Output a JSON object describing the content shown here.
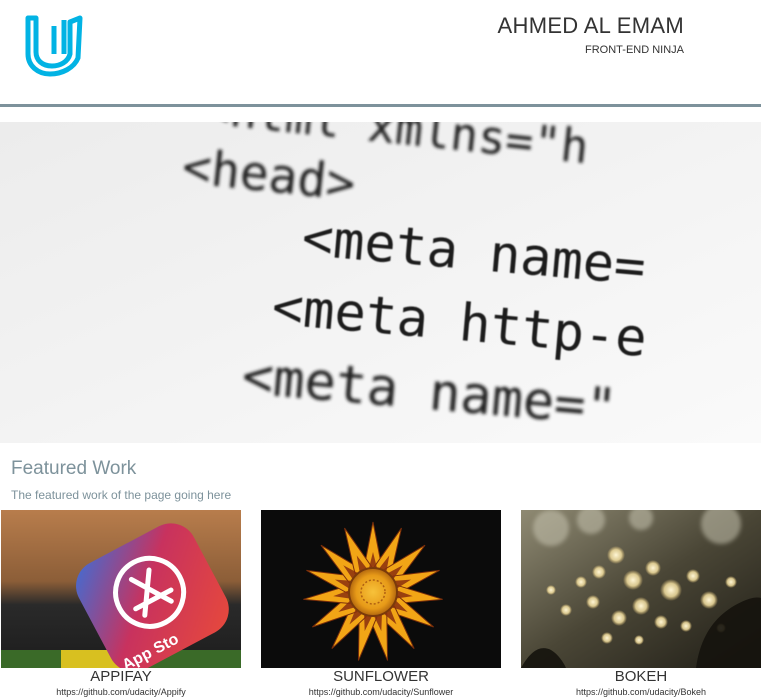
{
  "header": {
    "logo_icon": "udacity-u-logo-icon",
    "name": "AHMED AL EMAM",
    "subtitle": "FRONT-END NINJA",
    "accent_color": "#02b3e4",
    "divider_color": "#7d929b"
  },
  "hero": {
    "image": "html-code-closeup",
    "code_lines": [
      "<html  xmlns=\"h",
      "<head>",
      "<meta  name=",
      "<meta  http-e",
      "<meta  name=\""
    ]
  },
  "featured": {
    "title": "Featured Work",
    "description": "The featured work of the page going here",
    "items": [
      {
        "title": "APPIFAY",
        "link": "https://github.com/udacity/Appify",
        "image": "app-store-icon-image"
      },
      {
        "title": "SUNFLOWER",
        "link": "https://github.com/udacity/Sunflower",
        "image": "sunflower-image"
      },
      {
        "title": "BOKEH",
        "link": "https://github.com/udacity/Bokeh",
        "image": "bokeh-lights-image"
      }
    ]
  }
}
